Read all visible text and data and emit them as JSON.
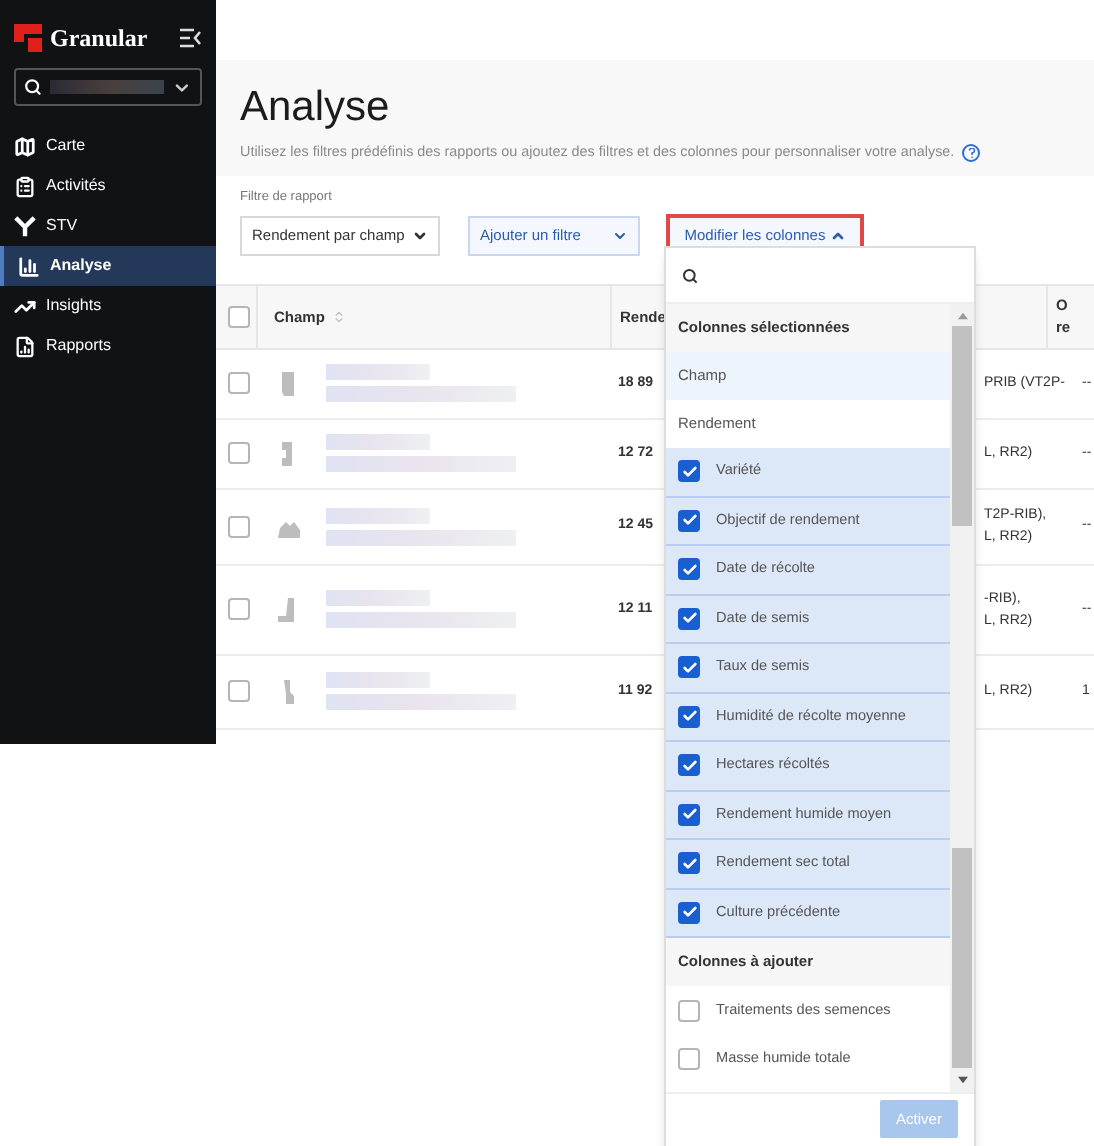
{
  "sidebar": {
    "brand": "Granular",
    "items": [
      {
        "label": "Carte",
        "selected": false
      },
      {
        "label": "Activités",
        "selected": false
      },
      {
        "label": "STV",
        "selected": false
      },
      {
        "label": "Analyse",
        "selected": true
      },
      {
        "label": "Insights",
        "selected": false
      },
      {
        "label": "Rapports",
        "selected": false
      }
    ]
  },
  "page": {
    "title": "Analyse",
    "subtitle": "Utilisez les filtres prédéfinis des rapports ou ajoutez des filtres et des colonnes pour personnaliser votre analyse.",
    "filter_label": "Filtre de rapport",
    "report_filter": "Rendement par champ",
    "add_filter": "Ajouter un filtre",
    "edit_columns": {
      "label": "Modifier les colonnes",
      "expanded": true
    }
  },
  "table": {
    "all_checked": false,
    "columns": [
      "Champ",
      "Rende",
      "O re"
    ],
    "rows": [
      {
        "checked": false,
        "rendement": "18 89",
        "column_3": [
          "PRIB (VT2P-"
        ],
        "column_4": "--"
      },
      {
        "checked": false,
        "rendement": "12 72",
        "column_3": [
          "L, RR2)"
        ],
        "column_4": "--"
      },
      {
        "checked": false,
        "rendement": "12 45",
        "column_3": [
          "T2P-RIB),",
          "L, RR2)"
        ],
        "column_4": "--"
      },
      {
        "checked": false,
        "rendement": "12 11",
        "column_3": [
          "-RIB),",
          "L, RR2)"
        ],
        "column_4": "--"
      },
      {
        "checked": false,
        "rendement": "11 92",
        "column_3": [
          "L, RR2)"
        ],
        "column_4": "1"
      }
    ]
  },
  "column_menu": {
    "sections": [
      {
        "title": "Colonnes sélectionnées",
        "items": [
          {
            "label": "Champ",
            "kind": "fixed",
            "checked": true
          },
          {
            "label": "Rendement",
            "kind": "fixed",
            "checked": false
          },
          {
            "label": "Variété",
            "kind": "check",
            "checked": true
          },
          {
            "label": "Objectif de rendement",
            "kind": "check",
            "checked": true
          },
          {
            "label": "Date de récolte",
            "kind": "check",
            "checked": true
          },
          {
            "label": "Date de semis",
            "kind": "check",
            "checked": true
          },
          {
            "label": "Taux de semis",
            "kind": "check",
            "checked": true
          },
          {
            "label": "Humidité de récolte moyenne",
            "kind": "check",
            "checked": true
          },
          {
            "label": "Hectares récoltés",
            "kind": "check",
            "checked": true
          },
          {
            "label": "Rendement humide moyen",
            "kind": "check",
            "checked": true
          },
          {
            "label": "Rendement sec total",
            "kind": "check",
            "checked": true
          },
          {
            "label": "Culture précédente",
            "kind": "check",
            "checked": true
          }
        ]
      },
      {
        "title": "Colonnes à ajouter",
        "items": [
          {
            "label": "Traitements des semences",
            "kind": "check",
            "checked": false
          },
          {
            "label": "Masse humide totale",
            "kind": "check",
            "checked": false
          }
        ]
      }
    ],
    "action": {
      "label": "Activer",
      "disabled": true
    }
  }
}
